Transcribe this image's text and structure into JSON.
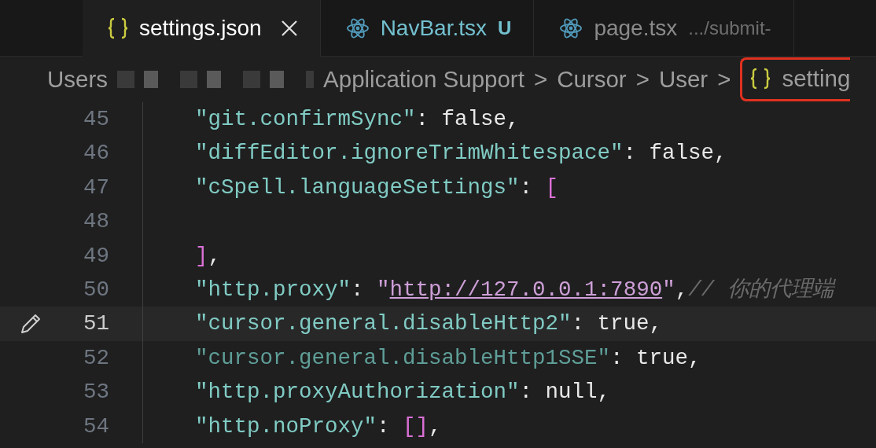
{
  "tabs": [
    {
      "label": "settings.json",
      "kind": "json",
      "selected": true
    },
    {
      "label": "NavBar.tsx",
      "kind": "tsx",
      "selected": false,
      "badge": "U"
    },
    {
      "label": "page.tsx",
      "kind": "tsx",
      "selected": false,
      "path": ".../submit-"
    }
  ],
  "breadcrumb": [
    {
      "kind": "text",
      "label": "Users"
    },
    {
      "kind": "redacted"
    },
    {
      "kind": "text",
      "label": "Application Support"
    },
    {
      "kind": "sep",
      "label": ">"
    },
    {
      "kind": "text",
      "label": "Cursor"
    },
    {
      "kind": "sep",
      "label": ">"
    },
    {
      "kind": "text",
      "label": "User"
    },
    {
      "kind": "sep",
      "label": ">"
    },
    {
      "kind": "file",
      "label": "setting",
      "highlighted": true
    }
  ],
  "lines": [
    {
      "number": "45",
      "current": false,
      "tokens": [
        {
          "kind": "key",
          "text": "\"git.confirmSync\""
        },
        {
          "kind": "punct",
          "text": ": false,"
        }
      ]
    },
    {
      "number": "46",
      "current": false,
      "tokens": [
        {
          "kind": "key",
          "text": "\"diffEditor.ignoreTrimWhitespace\""
        },
        {
          "kind": "punct",
          "text": ": false,"
        }
      ]
    },
    {
      "number": "47",
      "current": false,
      "tokens": [
        {
          "kind": "key",
          "text": "\"cSpell.languageSettings\""
        },
        {
          "kind": "punct",
          "text": ":"
        },
        {
          "kind": "bracket",
          "text": "["
        }
      ]
    },
    {
      "number": "48",
      "current": false
    },
    {
      "number": "49",
      "current": false,
      "tokens": [
        {
          "kind": "bracket",
          "text": "]"
        },
        {
          "kind": "punct",
          "text": ","
        }
      ]
    },
    {
      "number": "50",
      "current": false,
      "tokens": [
        {
          "kind": "key",
          "text": "\"http.proxy\""
        },
        {
          "kind": "punct",
          "text": ":"
        },
        {
          "kind": "string",
          "text": "\""
        },
        {
          "kind": "link",
          "text": "http://127.0.0.1:7890"
        },
        {
          "kind": "string",
          "text": "\""
        },
        {
          "kind": "punct",
          "text": ","
        },
        {
          "kind": "comment",
          "text": "// 你的代理端"
        }
      ]
    },
    {
      "number": "51",
      "current": true,
      "tokens": [
        {
          "kind": "key",
          "text": "\"cursor.general.disableHttp2\""
        },
        {
          "kind": "punct",
          "text": ": true,"
        }
      ]
    },
    {
      "number": "52",
      "current": false,
      "tokens": [
        {
          "kind": "key-dim",
          "text": "\"cursor.general.disableHttp1SSE\""
        },
        {
          "kind": "punct",
          "text": ": true,"
        }
      ]
    },
    {
      "number": "53",
      "current": false,
      "tokens": [
        {
          "kind": "key",
          "text": "\"http.proxyAuthorization\""
        },
        {
          "kind": "punct",
          "text": ": null,"
        }
      ]
    },
    {
      "number": "54",
      "current": false,
      "tokens": [
        {
          "kind": "key",
          "text": "\"http.noProxy\""
        },
        {
          "kind": "punct",
          "text": ":"
        },
        {
          "kind": "bracket",
          "text": "[]"
        },
        {
          "kind": "punct",
          "text": ","
        }
      ]
    }
  ]
}
